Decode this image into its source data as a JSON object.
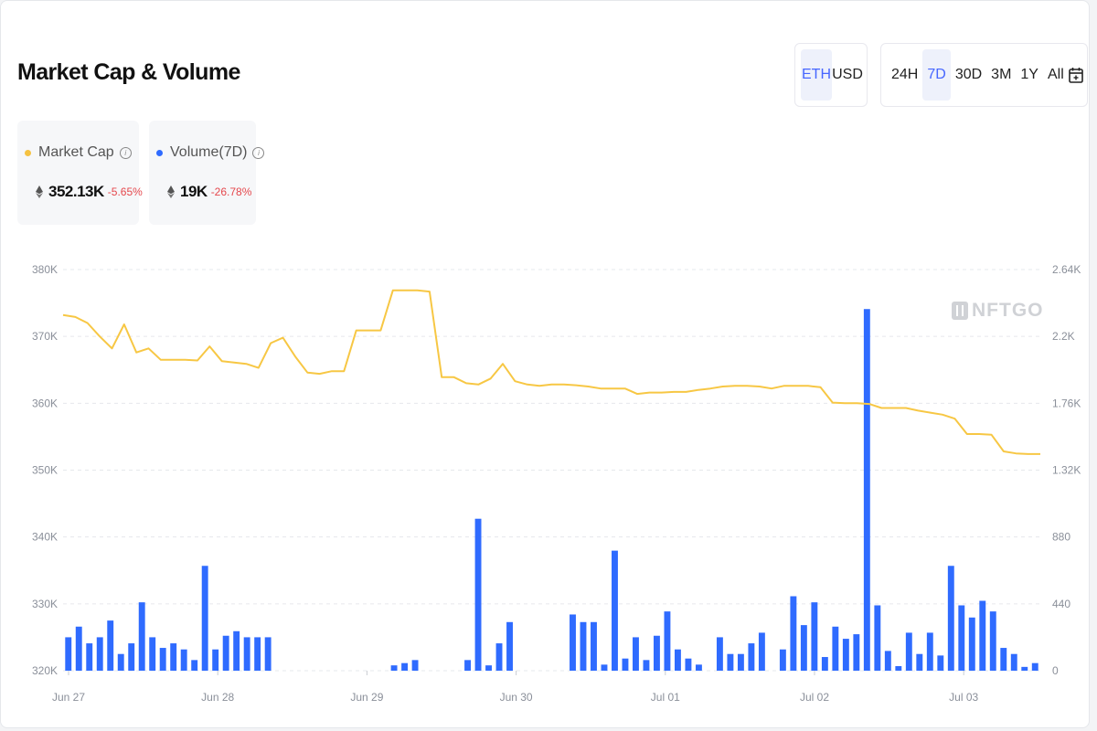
{
  "header": {
    "title": "Market Cap & Volume",
    "currency_options": [
      "ETH",
      "USD"
    ],
    "currency_selected": "ETH",
    "range_options": [
      "24H",
      "7D",
      "30D",
      "3M",
      "1Y",
      "All"
    ],
    "range_selected": "7D",
    "calendar_icon": "calendar-icon"
  },
  "stats": {
    "market_cap": {
      "label": "Market Cap",
      "value": "352.13K",
      "change": "-5.65%",
      "dot_color": "#f5c242",
      "change_color": "#e5484d"
    },
    "volume": {
      "label": "Volume(7D)",
      "value": "19K",
      "change": "-26.78%",
      "dot_color": "#2f6bff",
      "change_color": "#e5484d"
    }
  },
  "watermark": "NFTGO",
  "colors": {
    "line": "#f7c744",
    "bar": "#2f6bff",
    "grid": "#e6e8ec",
    "axis_text": "#8a8f99"
  },
  "chart_data": {
    "type": "line+bar",
    "x_ticks": [
      "Jun 27",
      "Jun 28",
      "Jun 29",
      "Jun 30",
      "Jul 01",
      "Jul 02",
      "Jul 03"
    ],
    "left_axis": {
      "ticks": [
        "380K",
        "370K",
        "360K",
        "350K",
        "340K",
        "330K",
        "320K"
      ],
      "ylim": [
        320000,
        380000
      ]
    },
    "right_axis": {
      "ticks": [
        "2.64K",
        "2.2K",
        "1.76K",
        "1.32K",
        "880",
        "440",
        "0"
      ],
      "ylim": [
        0,
        2640
      ]
    },
    "series": [
      {
        "name": "Market Cap",
        "type": "line",
        "axis": "left",
        "values": [
          373200,
          372900,
          372000,
          370000,
          368200,
          371800,
          367600,
          368200,
          366500,
          366500,
          366500,
          366400,
          368500,
          366300,
          366100,
          365900,
          365300,
          369000,
          369800,
          367000,
          364600,
          364400,
          364800,
          364800,
          370900,
          370900,
          370900,
          376900,
          376900,
          376900,
          376700,
          363900,
          363900,
          363000,
          362800,
          363700,
          365900,
          363300,
          362800,
          362600,
          362800,
          362800,
          362700,
          362500,
          362200,
          362200,
          362200,
          361400,
          361600,
          361600,
          361700,
          361700,
          362000,
          362200,
          362500,
          362600,
          362600,
          362500,
          362200,
          362600,
          362600,
          362600,
          362400,
          360100,
          360000,
          360000,
          359900,
          359300,
          359300,
          359300,
          358900,
          358600,
          358300,
          357700,
          355400,
          355400,
          355300,
          352800,
          352500,
          352400,
          352400
        ]
      },
      {
        "name": "Volume(7D)",
        "type": "bar",
        "axis": "right",
        "values": [
          220,
          290,
          180,
          220,
          330,
          110,
          180,
          450,
          220,
          150,
          180,
          140,
          70,
          690,
          140,
          230,
          260,
          220,
          220,
          220,
          0,
          0,
          0,
          0,
          0,
          0,
          0,
          0,
          0,
          0,
          0,
          35,
          50,
          70,
          0,
          0,
          0,
          0,
          70,
          1000,
          35,
          180,
          320,
          0,
          0,
          0,
          0,
          0,
          370,
          320,
          320,
          40,
          790,
          80,
          220,
          70,
          230,
          390,
          140,
          80,
          40,
          0,
          220,
          110,
          110,
          180,
          250,
          0,
          140,
          490,
          300,
          450,
          90,
          290,
          210,
          240,
          2380,
          430,
          130,
          30,
          250,
          110,
          250,
          100,
          690,
          430,
          350,
          460,
          390,
          150,
          110,
          25,
          50
        ]
      }
    ]
  }
}
